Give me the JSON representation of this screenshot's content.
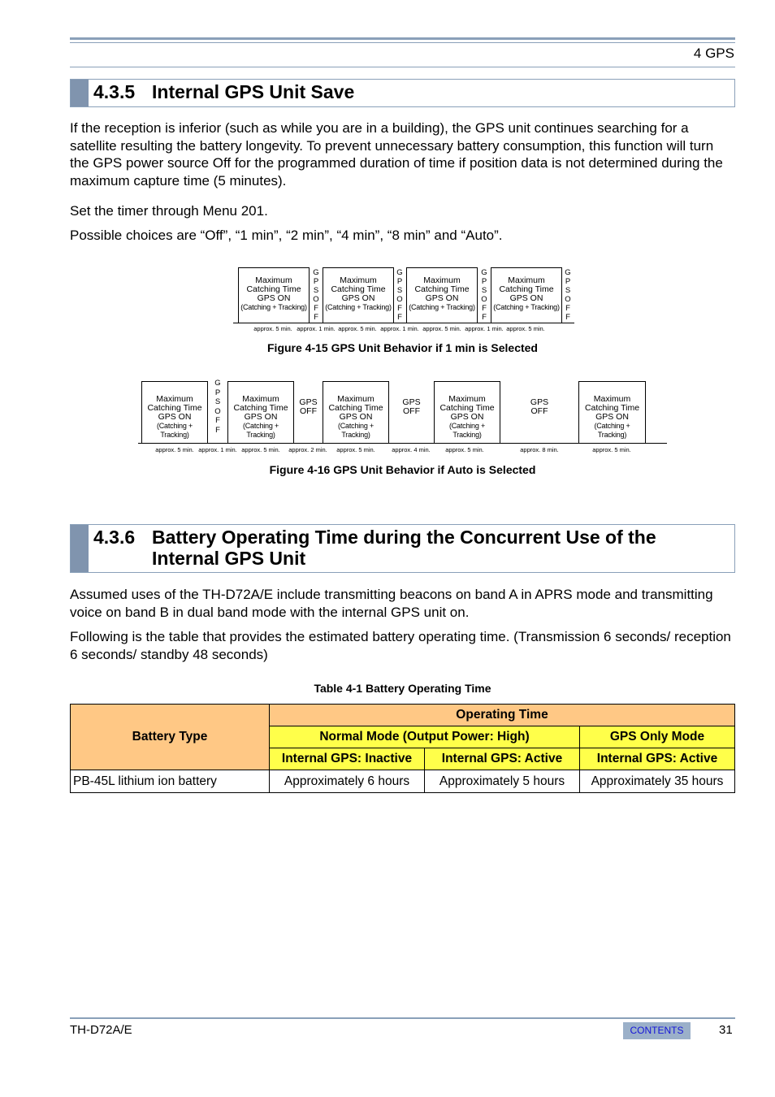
{
  "header": {
    "chapter": "4 GPS"
  },
  "section_435": {
    "number": "4.3.5",
    "title": "Internal GPS Unit Save",
    "paragraphs": [
      "If the reception is inferior (such as while you are in a building), the GPS unit continues searching for a satellite resulting the battery longevity.  To prevent unnecessary battery consumption, this function will turn the GPS power source Off for the programmed duration of time if position data is not determined during the maximum capture time (5 minutes).",
      "Set the timer through Menu 201.",
      "Possible choices are “Off”, “1 min”, “2 min”, “4 min”, “8 min” and “Auto”."
    ]
  },
  "block_text": {
    "line1": "Maximum",
    "line2": "Catching Time",
    "line3": "GPS ON",
    "line4": "(Catching + Tracking)",
    "off_vertical": [
      "G",
      "P",
      "S",
      "O",
      "F",
      "F"
    ],
    "off_line1": "GPS",
    "off_line2": "OFF"
  },
  "figure_4_15": {
    "caption": "Figure 4-15  GPS Unit Behavior if 1 min is Selected",
    "durations": [
      "approx. 5 min.",
      "approx. 1 min.",
      "approx. 5 min.",
      "approx. 1 min.",
      "approx. 5 min.",
      "approx. 1 min.",
      "approx. 5 min."
    ]
  },
  "figure_4_16": {
    "caption": "Figure 4-16  GPS Unit Behavior if Auto is Selected",
    "durations": [
      "approx. 5 min.",
      "approx. 1 min.",
      "approx. 5 min.",
      "approx. 2 min.",
      "approx. 5 min.",
      "approx. 4 min.",
      "approx. 5 min.",
      "approx. 8 min.",
      "approx. 5 min."
    ]
  },
  "section_436": {
    "number": "4.3.6",
    "title_line1": "Battery Operating Time during the Concurrent Use of the",
    "title_line2": "Internal GPS Unit",
    "paragraphs": [
      "Assumed uses of the TH-D72A/E include transmitting beacons on band A in APRS mode and transmitting voice on band B in dual band mode with the internal GPS unit on.",
      "Following is the table that provides the estimated battery operating time.  (Transmission 6 seconds/ reception 6 seconds/ standby 48 seconds)"
    ]
  },
  "table_4_1": {
    "caption": "Table 4-1  Battery Operating Time",
    "header_battery_type": "Battery Type",
    "header_operating_time": "Operating Time",
    "header_normal_mode": "Normal Mode (Output Power: High)",
    "header_gps_only": "GPS Only Mode",
    "sub_headers": [
      "Internal GPS: Inactive",
      "Internal GPS: Active",
      "Internal GPS: Active"
    ],
    "rows": [
      {
        "battery": "PB-45L lithium ion battery",
        "values": [
          "Approximately 6 hours",
          "Approximately 5 hours",
          "Approximately 35 hours"
        ]
      }
    ],
    "colors": {
      "header_orange": "#ffc885",
      "header_yellow": "#ffff4a"
    }
  },
  "footer": {
    "model": "TH-D72A/E",
    "contents_label": "CONTENTS",
    "page_number": "31"
  }
}
